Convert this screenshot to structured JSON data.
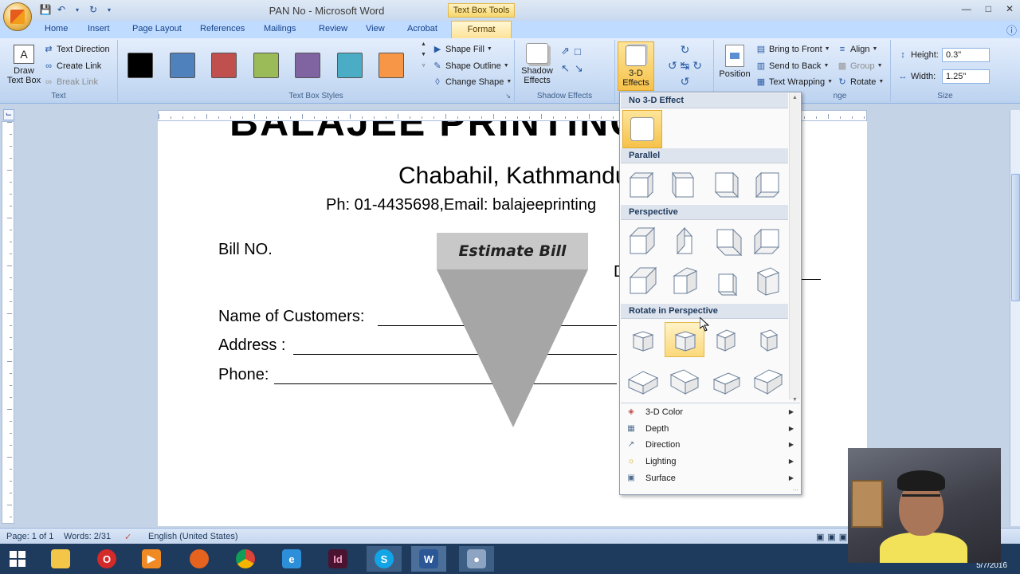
{
  "window": {
    "title": "PAN No - Microsoft Word",
    "context_tab_group": "Text Box Tools"
  },
  "tabs": [
    "Home",
    "Insert",
    "Page Layout",
    "References",
    "Mailings",
    "Review",
    "View",
    "Acrobat"
  ],
  "active_tab": "Format",
  "ribbon": {
    "text_group": {
      "label": "Text",
      "draw_text_box": "Draw Text Box",
      "text_direction": "Text Direction",
      "create_link": "Create Link",
      "break_link": "Break Link"
    },
    "text_box_styles": {
      "label": "Text Box Styles",
      "swatches": [
        "#000000",
        "#4f81bd",
        "#c0504d",
        "#9bbb59",
        "#8064a2",
        "#4bacc6",
        "#f79646"
      ],
      "shape_fill": "Shape Fill",
      "shape_outline": "Shape Outline",
      "change_shape": "Change Shape"
    },
    "shadow_effects": {
      "label": "Shadow Effects",
      "button": "Shadow Effects"
    },
    "three_d": {
      "button": "3-D Effects"
    },
    "arrange": {
      "label": "Arrange",
      "position": "Position",
      "bring_to_front": "Bring to Front",
      "send_to_back": "Send to Back",
      "text_wrapping": "Text Wrapping",
      "align": "Align",
      "group": "Group",
      "rotate": "Rotate"
    },
    "size": {
      "label": "Size",
      "height_label": "Height:",
      "height_value": "0.3\"",
      "width_label": "Width:",
      "width_value": "1.25\""
    }
  },
  "document": {
    "heading_partial": "BALAJEE PRINTING",
    "address": "Chabahil, Kathmandu",
    "contact": "Ph: 01-4435698,Email: balajeeprinting",
    "bill_no": "Bill NO.",
    "shape_text": "Estimate Bill",
    "partial_right": "D",
    "name_label": "Name of Customers:",
    "address_label": "Address :",
    "phone_label": "Phone:"
  },
  "menu_3d": {
    "sections": {
      "none": "No 3-D Effect",
      "parallel": "Parallel",
      "perspective": "Perspective",
      "rotate_in_perspective": "Rotate in Perspective"
    },
    "commands": [
      {
        "label": "3-D Color",
        "icon": "paint-bucket-icon"
      },
      {
        "label": "Depth",
        "icon": "depth-icon"
      },
      {
        "label": "Direction",
        "icon": "direction-icon"
      },
      {
        "label": "Lighting",
        "icon": "lightbulb-icon"
      },
      {
        "label": "Surface",
        "icon": "surface-icon"
      }
    ]
  },
  "statusbar": {
    "page": "Page: 1 of 1",
    "words": "Words: 2/31",
    "language": "English (United States)"
  },
  "taskbar": {
    "clock_date": "5/7/2016"
  }
}
